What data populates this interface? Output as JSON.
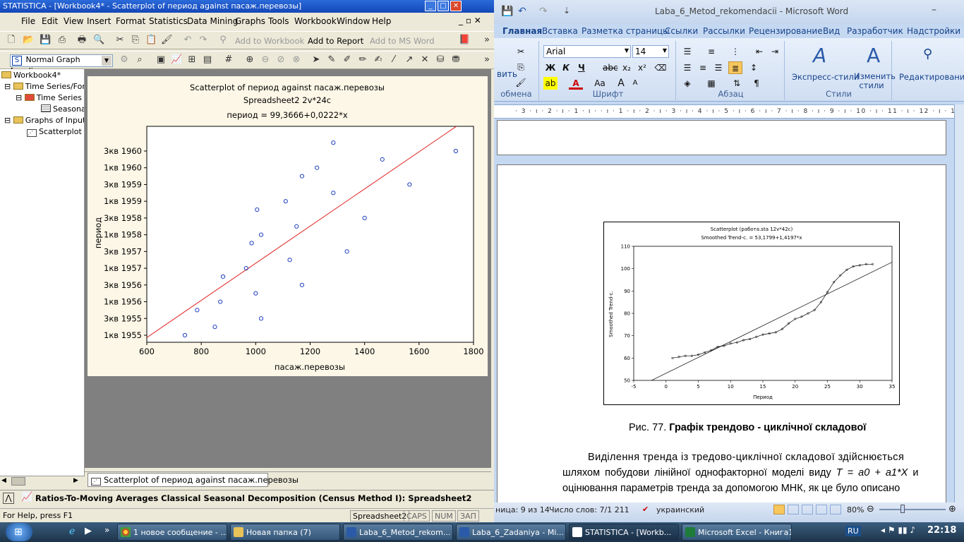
{
  "statistica": {
    "title": "STATISTICA - [Workbook4* - Scatterplot of период against пасаж.перевозы]",
    "menu": [
      "File",
      "Edit",
      "View",
      "Insert",
      "Format",
      "Statistics",
      "Data Mining",
      "Graphs",
      "Tools",
      "Workbook",
      "Window",
      "Help"
    ],
    "toolbar1": {
      "add_to_workbook": "Add to Workbook",
      "add_to_report": "Add to Report",
      "add_to_msword": "Add to MS Word"
    },
    "toolbar2": {
      "graph_mode": "Normal Graph [modi..."
    },
    "tree": [
      "Workbook4*",
      "Time Series/Fore",
      "Time Series s",
      "Seasona",
      "Graphs of Input",
      "Scatterplot o"
    ],
    "tab_label": "Scatterplot of период against пасаж.перевозы",
    "report_label": "Ratios-To-Moving Averages Classical Seasonal Decomposition (Census Method I): Spreadsheet2",
    "status": {
      "help": "For Help, press F1",
      "sheet": "Spreadsheet2",
      "caps": "CAPS",
      "num": "NUM",
      "ovr": "ЗАП"
    }
  },
  "chart_data": {
    "type": "scatter",
    "title": "Scatterplot of период against пасаж.перевозы",
    "subtitle": "Spreadsheet2 2v*24c",
    "equation": "период = 99,3666+0,0222*x",
    "xlabel": "пасаж.перевозы",
    "ylabel": "период",
    "xlim": [
      600,
      1800
    ],
    "xticks": [
      "600",
      "800",
      "1000",
      "1200",
      "1400",
      "1600",
      "1800"
    ],
    "yticks": [
      "1кв 1955",
      "3кв 1955",
      "1кв 1956",
      "3кв 1956",
      "1кв 1957",
      "3кв 1957",
      "1кв 1958",
      "3кв 1958",
      "1кв 1959",
      "3кв 1959",
      "1кв 1960",
      "3кв 1960"
    ],
    "points": [
      {
        "x": 740,
        "y": 0
      },
      {
        "x": 850,
        "y": 0.5
      },
      {
        "x": 1020,
        "y": 1
      },
      {
        "x": 785,
        "y": 1.5
      },
      {
        "x": 870,
        "y": 2
      },
      {
        "x": 1000,
        "y": 2.5
      },
      {
        "x": 1170,
        "y": 3
      },
      {
        "x": 880,
        "y": 3.5
      },
      {
        "x": 965,
        "y": 4
      },
      {
        "x": 1125,
        "y": 4.5
      },
      {
        "x": 1335,
        "y": 5
      },
      {
        "x": 985,
        "y": 5.5
      },
      {
        "x": 1020,
        "y": 6
      },
      {
        "x": 1150,
        "y": 6.5
      },
      {
        "x": 1400,
        "y": 7
      },
      {
        "x": 1005,
        "y": 7.5
      },
      {
        "x": 1110,
        "y": 8
      },
      {
        "x": 1285,
        "y": 8.5
      },
      {
        "x": 1565,
        "y": 9
      },
      {
        "x": 1170,
        "y": 9.5
      },
      {
        "x": 1225,
        "y": 10
      },
      {
        "x": 1465,
        "y": 10.5
      },
      {
        "x": 1735,
        "y": 11
      },
      {
        "x": 1285,
        "y": 11.5
      }
    ],
    "regression_color": "#e02020",
    "point_color": "#1f3fbf"
  },
  "word": {
    "title": "Laba_6_Metod_rekomendacii - Microsoft Word",
    "tabs": [
      "Главная",
      "Вставка",
      "Разметка страницы",
      "Ссылки",
      "Рассылки",
      "Рецензирование",
      "Вид",
      "Разработчик",
      "Надстройки"
    ],
    "font_name": "Arial",
    "font_size": "14",
    "groups": {
      "clipboard": "обмена",
      "font": "Шрифт",
      "paragraph": "Абзац",
      "styles": "Стили"
    },
    "clipboard_insert": "вить",
    "express_styles": "Экспресс-стили",
    "change_styles": "Изменить стили",
    "editing": "Редактирование",
    "ruler": "· 3 · ı · 2 · ı · 1 · ı ·   · ı · 1 · ı · 2 · ı · 3 · ı · 4 · ı · 5 · ı · 6 · ı · 7 · ı · 8 · ı · 9 · ı · 10 · ı · 11 · ı · 12 · ı · 13 · ı · 14 · ı · 15 · ı · 16 · ı · 17 · ı ·",
    "figure_caption_prefix": "Рис. 77.",
    "figure_caption_bold": "Графік трендово - циклічної складової",
    "paragraph_lines": [
      "Виділення тренда із тредово-циклічної складової здійснюється",
      "шляхом побудови лінійної однофакторної моделі виду",
      "оцінювання параметрів тренда за допомогою МНК, як це було описано"
    ],
    "model_formula": "T = a0 + a1*X",
    "model_conj": "и",
    "status": {
      "pages": "ница: 9 из 14",
      "words": "Число слов: 7/1 211",
      "lang": "украинский",
      "zoom": "80%"
    }
  },
  "embedded_chart": {
    "title": "Scatterplot (работа.sta 12v*42c)",
    "subtitle": "Smoothed Trend-c. = 53,1799+1,4197*x",
    "xlabel": "Период",
    "ylabel": "Smoothed Trend-c.",
    "xticks": [
      "-5",
      "0",
      "5",
      "10",
      "15",
      "20",
      "25",
      "30",
      "35"
    ],
    "yticks": [
      "50",
      "60",
      "70",
      "80",
      "90",
      "100",
      "110"
    ]
  },
  "taskbar": {
    "items": [
      "1 новое сообщение - ...",
      "Новая папка (7)",
      "Laba_6_Metod_rekom...",
      "Laba_6_Zadaniya - Mi...",
      "STATISTICA - [Workb...",
      "Microsoft Excel - Книга1"
    ],
    "lang": "RU",
    "clock": "22:18"
  }
}
